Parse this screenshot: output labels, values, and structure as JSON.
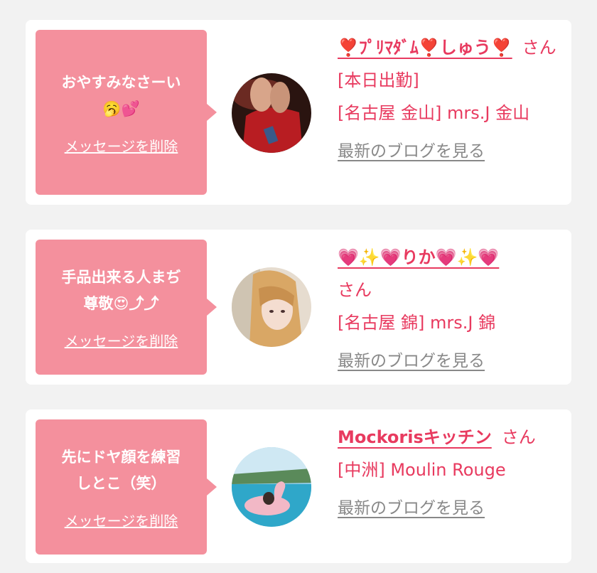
{
  "items": [
    {
      "message": "おやすみなさーい\n🥱💕",
      "delete_label": "メッセージを削除",
      "name": "❣️ﾌﾟﾘﾏﾀﾞﾑ❣️しゅう❣️",
      "honorific": "さん",
      "status": "[本日出勤]",
      "shop": "[名古屋 金山] mrs.J 金山",
      "blog_label": "最新のブログを見る",
      "avatar": "photo-avatar-red-dress"
    },
    {
      "message": "手品出来る人まぢ\n尊敬😍⤴⤴",
      "delete_label": "メッセージを削除",
      "name": "💗✨💗りか💗✨💗",
      "honorific": "さん",
      "status": "",
      "shop": "[名古屋 錦] mrs.J 錦",
      "blog_label": "最新のブログを見る",
      "avatar": "photo-avatar-blonde-woman"
    },
    {
      "message": "先にドヤ顔を練習\nしとこ（笑）",
      "delete_label": "メッセージを削除",
      "name": "Mockorisキッチン",
      "honorific": "さん",
      "status": "",
      "shop": "[中洲] Moulin Rouge",
      "blog_label": "最新のブログを見る",
      "avatar": "photo-avatar-pool-flamingo"
    }
  ]
}
